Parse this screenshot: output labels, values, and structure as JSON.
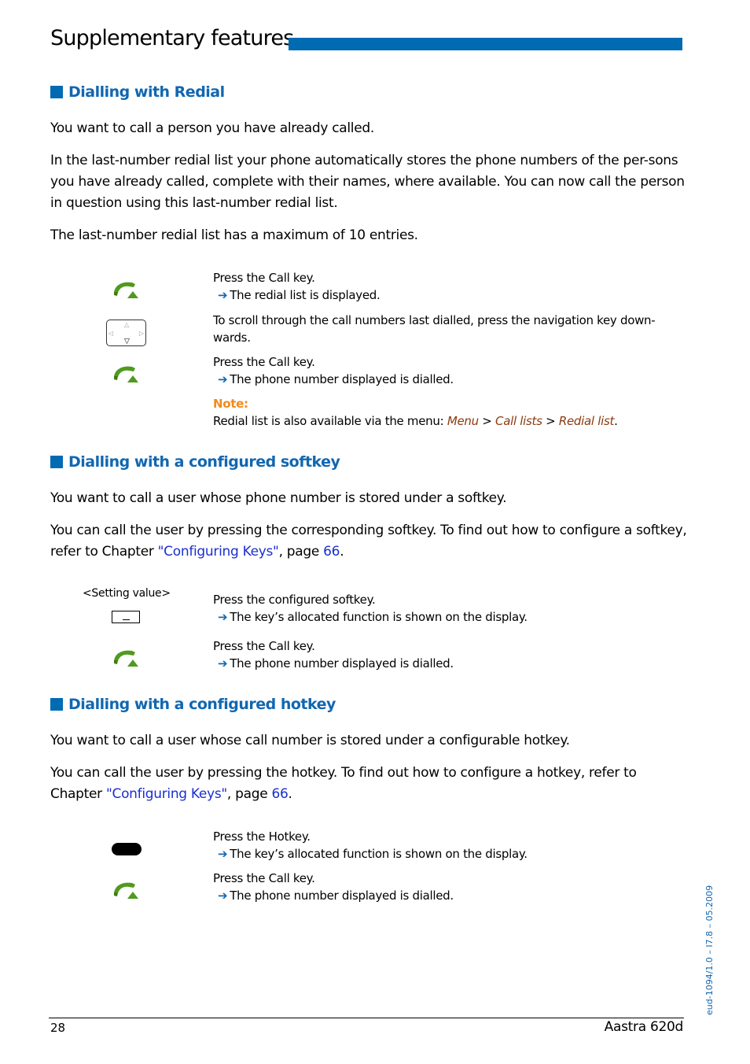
{
  "header": {
    "title": "Supplementary features",
    "accent_color": "#006ab3"
  },
  "sections": [
    {
      "heading": "Dialling with Redial",
      "paragraphs": [
        "You want to call a person you have already called.",
        "In the last-number redial list your phone automatically stores the phone numbers of the per-sons you have already called, complete with their names, where available. You can now call the person in question using this last-number redial list.",
        "The last-number redial list has a maximum of 10 entries."
      ],
      "steps": [
        {
          "icon": "call-key-icon",
          "text": "Press the Call key.",
          "result": "The redial list is displayed."
        },
        {
          "icon": "navigation-key-icon",
          "text": "To scroll through the call numbers last dialled, press the navigation key down-wards."
        },
        {
          "icon": "call-key-icon",
          "text": "Press the Call key.",
          "result": "The phone number displayed is dialled."
        }
      ],
      "note": {
        "label": "Note:",
        "text_prefix": "Redial list is also available via the menu: ",
        "path": [
          "Menu",
          "Call lists",
          "Redial list"
        ],
        "separator": " > ",
        "suffix": "."
      }
    },
    {
      "heading": "Dialling with a configured softkey",
      "paragraphs": [
        "You want to call a user whose phone number is stored under a softkey."
      ],
      "ref_paragraph": {
        "before": "You can call the user by pressing the corresponding softkey. To find out how to configure a softkey, refer to Chapter ",
        "link": "\"Configuring Keys\"",
        "middle": ", page ",
        "page": "66",
        "after": "."
      },
      "setting_label": "<Setting value>",
      "steps": [
        {
          "icon": "softkey-icon",
          "text": "Press the configured softkey.",
          "result": "The key’s allocated function is shown on the display."
        },
        {
          "icon": "call-key-icon",
          "text": "Press the Call key.",
          "result": "The phone number displayed is dialled."
        }
      ]
    },
    {
      "heading": "Dialling with a configured hotkey",
      "paragraphs": [
        "You want to call a user whose call number is stored under a configurable hotkey."
      ],
      "ref_paragraph": {
        "before": "You can call the user by pressing the hotkey. To find out how to configure a hotkey, refer to Chapter ",
        "link": "\"Configuring Keys\"",
        "middle": ", page ",
        "page": "66",
        "after": "."
      },
      "steps": [
        {
          "icon": "hotkey-icon",
          "text": "Press the Hotkey.",
          "result": "The key’s allocated function is shown on the display."
        },
        {
          "icon": "call-key-icon",
          "text": "Press the Call key.",
          "result": "The phone number displayed is dialled."
        }
      ]
    }
  ],
  "arrow_glyph": "➔",
  "footer": {
    "page_number": "28",
    "product": "Aastra 620d",
    "doc_id": "eud-1094/1.0 – I7.8 – 05.2009"
  }
}
